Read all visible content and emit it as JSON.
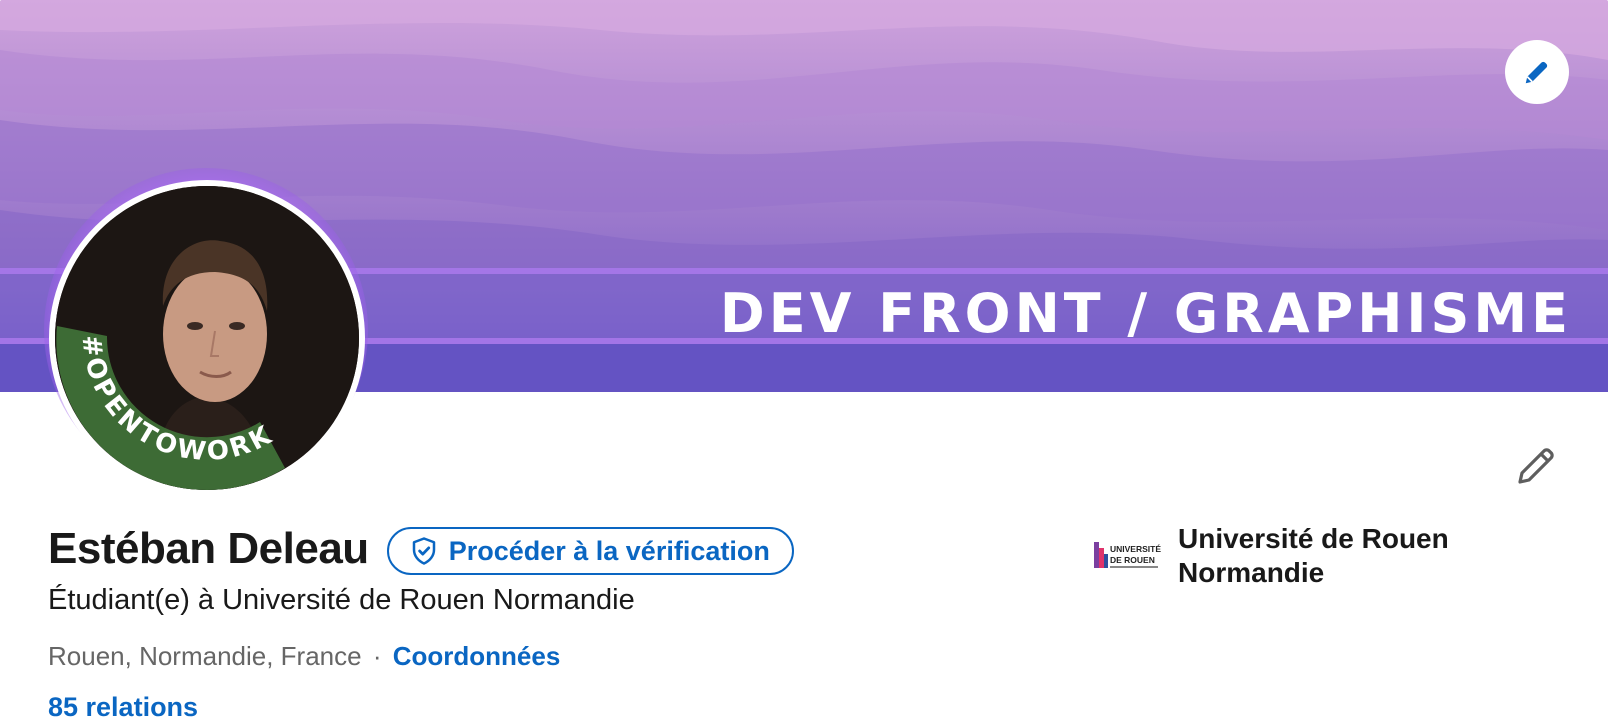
{
  "banner": {
    "text": "DEV FRONT / GRAPHISME",
    "colors": {
      "top": "#d2a8dd",
      "mid": "#a77fd0",
      "bottom": "#6b58c6",
      "stripe": "#9b6be6"
    }
  },
  "avatar": {
    "badge_text": "#OPENTOWORK",
    "badge_color": "#3d6b35"
  },
  "profile": {
    "name": "Estéban Deleau",
    "verify_label": "Procéder à la vérification",
    "headline": "Étudiant(e) à Université de Rouen Normandie",
    "location": "Rouen, Normandie, France",
    "separator": "·",
    "contact_label": "Coordonnées",
    "connections": "85 relations"
  },
  "school": {
    "name": "Université de Rouen Normandie",
    "logo_text_top": "UNIVERSITÉ",
    "logo_text_bottom": "DE ROUEN"
  },
  "icons": {
    "banner_edit": "pencil-icon",
    "profile_edit": "pencil-icon",
    "verify": "shield-check-icon"
  },
  "colors": {
    "link": "#0a66c2",
    "text": "#191919",
    "muted": "#666666"
  }
}
